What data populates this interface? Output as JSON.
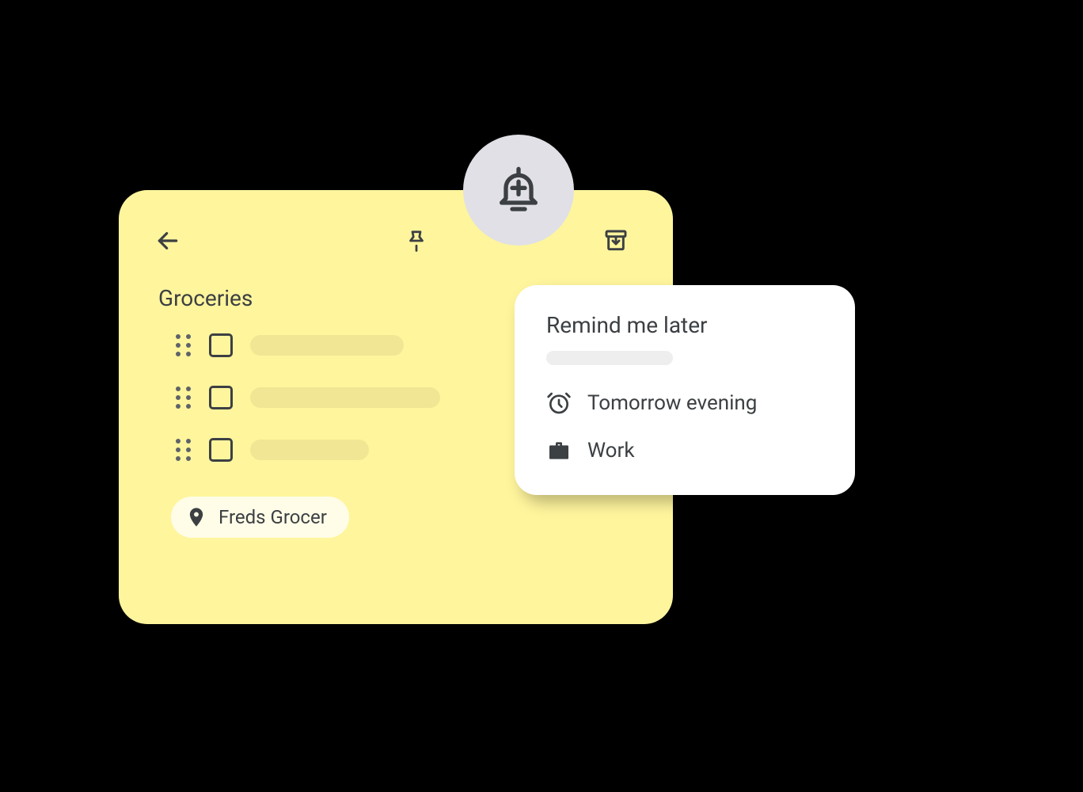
{
  "note": {
    "title": "Groceries",
    "checklist_items": [
      {
        "placeholder_width": 194
      },
      {
        "placeholder_width": 240
      },
      {
        "placeholder_width": 150
      }
    ],
    "location_chip": "Freds Grocer"
  },
  "header_icons": {
    "back": "arrow-back",
    "pin": "pushpin",
    "bell": "bell-add",
    "archive": "archive"
  },
  "reminder_popup": {
    "title": "Remind me later",
    "options": [
      {
        "icon": "alarm",
        "label": "Tomorrow evening"
      },
      {
        "icon": "briefcase",
        "label": "Work"
      }
    ]
  },
  "colors": {
    "note_bg": "#FFF59D",
    "text": "#3c4043",
    "bell_circle": "#e0e0e6",
    "popup_bg": "#ffffff"
  }
}
